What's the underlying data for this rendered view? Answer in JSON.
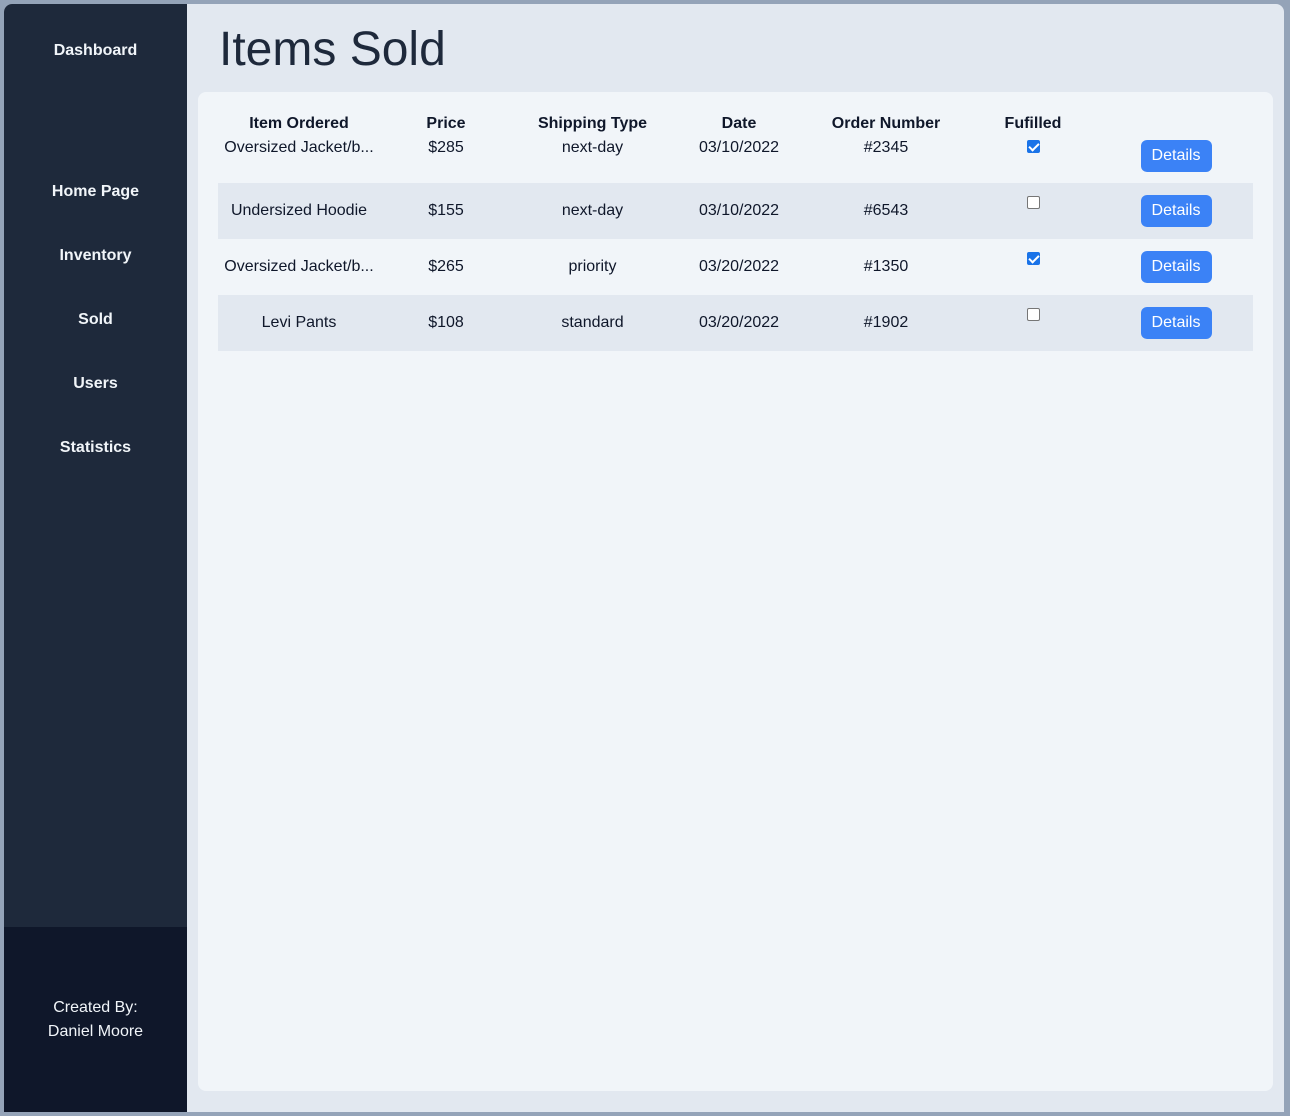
{
  "sidebar": {
    "brand": "Dashboard",
    "items": [
      {
        "label": "Home Page"
      },
      {
        "label": "Inventory"
      },
      {
        "label": "Sold"
      },
      {
        "label": "Users"
      },
      {
        "label": "Statistics"
      }
    ],
    "footer": {
      "line1": "Created By:",
      "line2": "Daniel Moore"
    }
  },
  "main": {
    "title": "Items Sold",
    "table": {
      "headers": [
        "Item Ordered",
        "Price",
        "Shipping Type",
        "Date",
        "Order Number",
        "Fufilled",
        ""
      ],
      "rows": [
        {
          "item": "Oversized Jacket/b...",
          "price": "$285",
          "shipping": "next-day",
          "date": "03/10/2022",
          "order": "#2345",
          "fulfilled": true,
          "action": "Details"
        },
        {
          "item": "Undersized Hoodie",
          "price": "$155",
          "shipping": "next-day",
          "date": "03/10/2022",
          "order": "#6543",
          "fulfilled": false,
          "action": "Details"
        },
        {
          "item": "Oversized Jacket/b...",
          "price": "$265",
          "shipping": "priority",
          "date": "03/20/2022",
          "order": "#1350",
          "fulfilled": true,
          "action": "Details"
        },
        {
          "item": "Levi Pants",
          "price": "$108",
          "shipping": "standard",
          "date": "03/20/2022",
          "order": "#1902",
          "fulfilled": false,
          "action": "Details"
        }
      ]
    }
  },
  "colors": {
    "sidebar_bg": "#1e293b",
    "footer_bg": "#0f172a",
    "content_bg": "#e2e8f0",
    "card_bg": "#f1f5f9",
    "button_bg": "#3b82f6",
    "checkbox_checked": "#1a73e8"
  }
}
